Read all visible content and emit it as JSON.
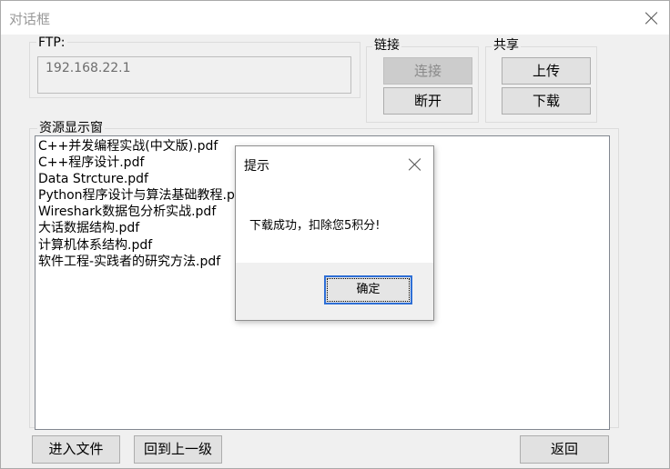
{
  "window": {
    "title": "对话框"
  },
  "ftp": {
    "label": "FTP:",
    "address": "192.168.22.1"
  },
  "connection": {
    "label": "链接",
    "connect_label": "连接",
    "disconnect_label": "断开"
  },
  "share": {
    "label": "共享",
    "upload_label": "上传",
    "download_label": "下载"
  },
  "resources": {
    "label": "资源显示窗",
    "items": [
      "C++并发编程实战(中文版).pdf",
      "C++程序设计.pdf",
      "Data Strcture.pdf",
      "Python程序设计与算法基础教程.pdf",
      "Wireshark数据包分析实战.pdf",
      "大话数据结构.pdf",
      "计算机体系结构.pdf",
      "软件工程-实践者的研究方法.pdf"
    ]
  },
  "bottom_bar": {
    "enter_file_label": "进入文件",
    "go_up_label": "回到上一级",
    "back_label": "返回"
  },
  "message_box": {
    "title": "提示",
    "message": "下载成功，扣除您5积分!",
    "ok_label": "确定"
  },
  "colors": {
    "window_bg": "#f0f0f0",
    "focus_border": "#2e6fd6"
  }
}
